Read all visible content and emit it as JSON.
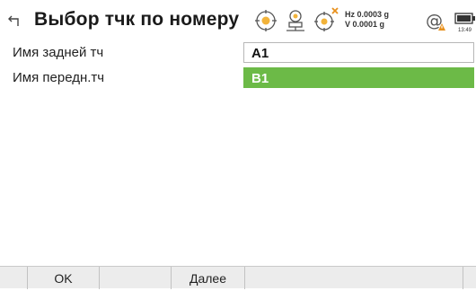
{
  "header": {
    "title": "Выбор тчк по номеру",
    "back_icon": "back-arrow-icon"
  },
  "status": {
    "icons": [
      "target-prism-icon",
      "instrument-icon",
      "tracking-off-icon",
      "connection-warning-icon",
      "battery-icon"
    ],
    "compensator": {
      "hz": "Hz 0.0003 g",
      "v": "V   0.0001 g"
    },
    "time": "13:49",
    "colors": {
      "warning": "#e8901c",
      "cross": "#e8901c",
      "accent": "#6cba47"
    }
  },
  "form": {
    "rows": [
      {
        "label": "Имя задней тч",
        "value": "A1",
        "state": "normal"
      },
      {
        "label": "Имя передн.тч",
        "value": "B1",
        "state": "selected"
      }
    ]
  },
  "softkeys": {
    "ok": "OK",
    "next": "Далее"
  }
}
